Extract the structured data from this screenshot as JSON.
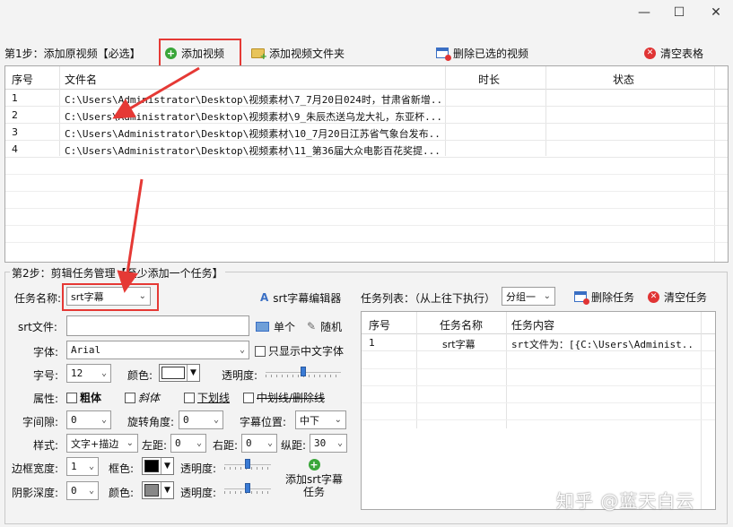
{
  "window": {
    "minimize": "—",
    "maximize": "☐",
    "close": "✕"
  },
  "step1": {
    "label": "第1步：添加原视频【必选】",
    "add_video": "添加视频",
    "add_folder": "添加视频文件夹",
    "delete_selected": "删除已选的视频",
    "clear_table": "清空表格"
  },
  "video_table": {
    "columns": [
      "序号",
      "文件名",
      "时长",
      "状态"
    ],
    "rows": [
      {
        "index": "1",
        "file": "C:\\Users\\Administrator\\Desktop\\视频素材\\7_7月20日024时，甘肃省新增..."
      },
      {
        "index": "2",
        "file": "C:\\Users\\Administrator\\Desktop\\视频素材\\9_朱辰杰送乌龙大礼，东亚杯..."
      },
      {
        "index": "3",
        "file": "C:\\Users\\Administrator\\Desktop\\视频素材\\10_7月20日江苏省气象台发布..."
      },
      {
        "index": "4",
        "file": "C:\\Users\\Administrator\\Desktop\\视频素材\\11_第36届大众电影百花奖提..."
      }
    ]
  },
  "step2": {
    "label": "第2步：剪辑任务管理【至少添加一个任务】",
    "task_name_label": "任务名称:",
    "task_name_value": "srt字幕",
    "srt_editor": "srt字幕编辑器",
    "srt_file_label": "srt文件:",
    "srt_file_value": "",
    "single": "单个",
    "random": "随机",
    "font_label": "字体:",
    "font_value": "Arial",
    "only_chinese": "只显示中文字体",
    "size_label": "字号:",
    "size_value": "12",
    "color_label": "颜色:",
    "opacity_label": "透明度:",
    "opacity_level": 0.5,
    "attr_label": "属性:",
    "bold": "粗体",
    "italic": "斜体",
    "underline": "下划线",
    "strike": "中划线/删除线",
    "spacing_label": "字间隙:",
    "spacing_value": "0",
    "rotation_label": "旋转角度:",
    "rotation_value": "0",
    "position_label": "字幕位置:",
    "position_value": "中下",
    "style_label": "样式:",
    "style_value": "文字+描边",
    "left_label": "左距:",
    "left_value": "0",
    "right_label": "右距:",
    "right_value": "0",
    "vert_label": "纵距:",
    "vert_value": "30",
    "border_label": "边框宽度:",
    "border_value": "1",
    "border_color_label": "框色:",
    "border_opacity_label": "透明度:",
    "border_opacity_level": 0.5,
    "shadow_label": "阴影深度:",
    "shadow_value": "0",
    "shadow_color_label": "颜色:",
    "shadow_opacity_label": "透明度:",
    "shadow_opacity_level": 0.5,
    "add_task_line1": "添加srt字幕",
    "add_task_line2": "任务",
    "task_list_label": "任务列表：（从上往下执行）",
    "group_value": "分组一",
    "delete_task": "删除任务",
    "clear_task": "清空任务"
  },
  "task_table": {
    "columns": [
      "序号",
      "任务名称",
      "任务内容"
    ],
    "rows": [
      {
        "index": "1",
        "name": "srt字幕",
        "content": "srt文件为：[{C:\\Users\\Administ..."
      }
    ]
  },
  "colors": {
    "font_color": "#ffffff",
    "border_color": "#000000",
    "shadow_color": "#888888",
    "annotation": "#e53935"
  },
  "watermark": "知乎 @蓝天白云"
}
